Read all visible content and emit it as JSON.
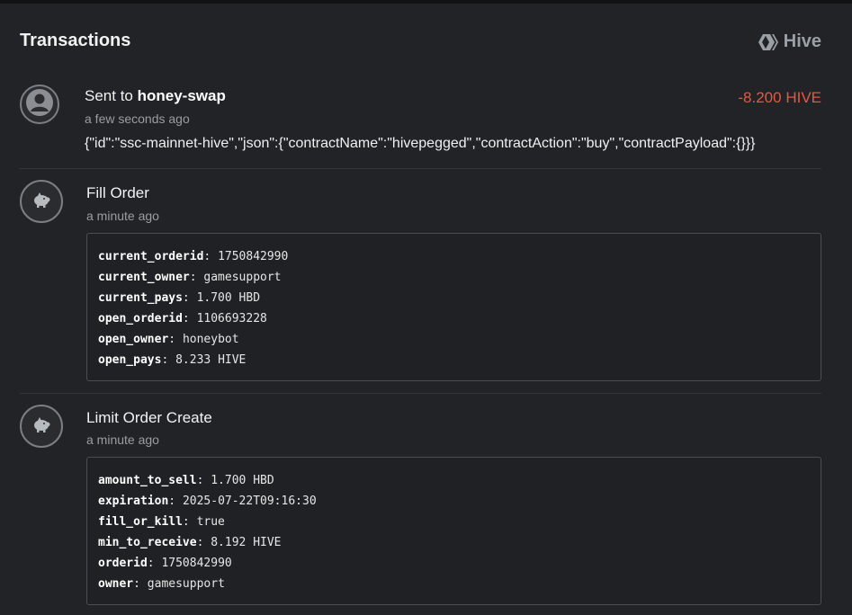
{
  "page": {
    "title": "Transactions",
    "brand": "Hive"
  },
  "transactions": [
    {
      "title_prefix": "Sent to ",
      "counterparty": "honey-swap",
      "time": "a few seconds ago",
      "amount": "-8.200 HIVE",
      "memo": "{\"id\":\"ssc-mainnet-hive\",\"json\":{\"contractName\":\"hivepegged\",\"contractAction\":\"buy\",\"contractPayload\":{}}}",
      "icon": "user-icon"
    },
    {
      "title": "Fill Order",
      "time": "a minute ago",
      "icon": "piggy-bank-icon",
      "fields": [
        {
          "key": "current_orderid",
          "value": "1750842990"
        },
        {
          "key": "current_owner",
          "value": "gamesupport"
        },
        {
          "key": "current_pays",
          "value": "1.700 HBD"
        },
        {
          "key": "open_orderid",
          "value": "1106693228"
        },
        {
          "key": "open_owner",
          "value": "honeybot"
        },
        {
          "key": "open_pays",
          "value": "8.233 HIVE"
        }
      ]
    },
    {
      "title": "Limit Order Create",
      "time": "a minute ago",
      "icon": "piggy-bank-icon",
      "fields": [
        {
          "key": "amount_to_sell",
          "value": "1.700 HBD"
        },
        {
          "key": "expiration",
          "value": "2025-07-22T09:16:30"
        },
        {
          "key": "fill_or_kill",
          "value": "true"
        },
        {
          "key": "min_to_receive",
          "value": "8.192 HIVE"
        },
        {
          "key": "orderid",
          "value": "1750842990"
        },
        {
          "key": "owner",
          "value": "gamesupport"
        }
      ]
    }
  ],
  "colors": {
    "negative_amount": "#e9573f",
    "background": "#212326"
  }
}
